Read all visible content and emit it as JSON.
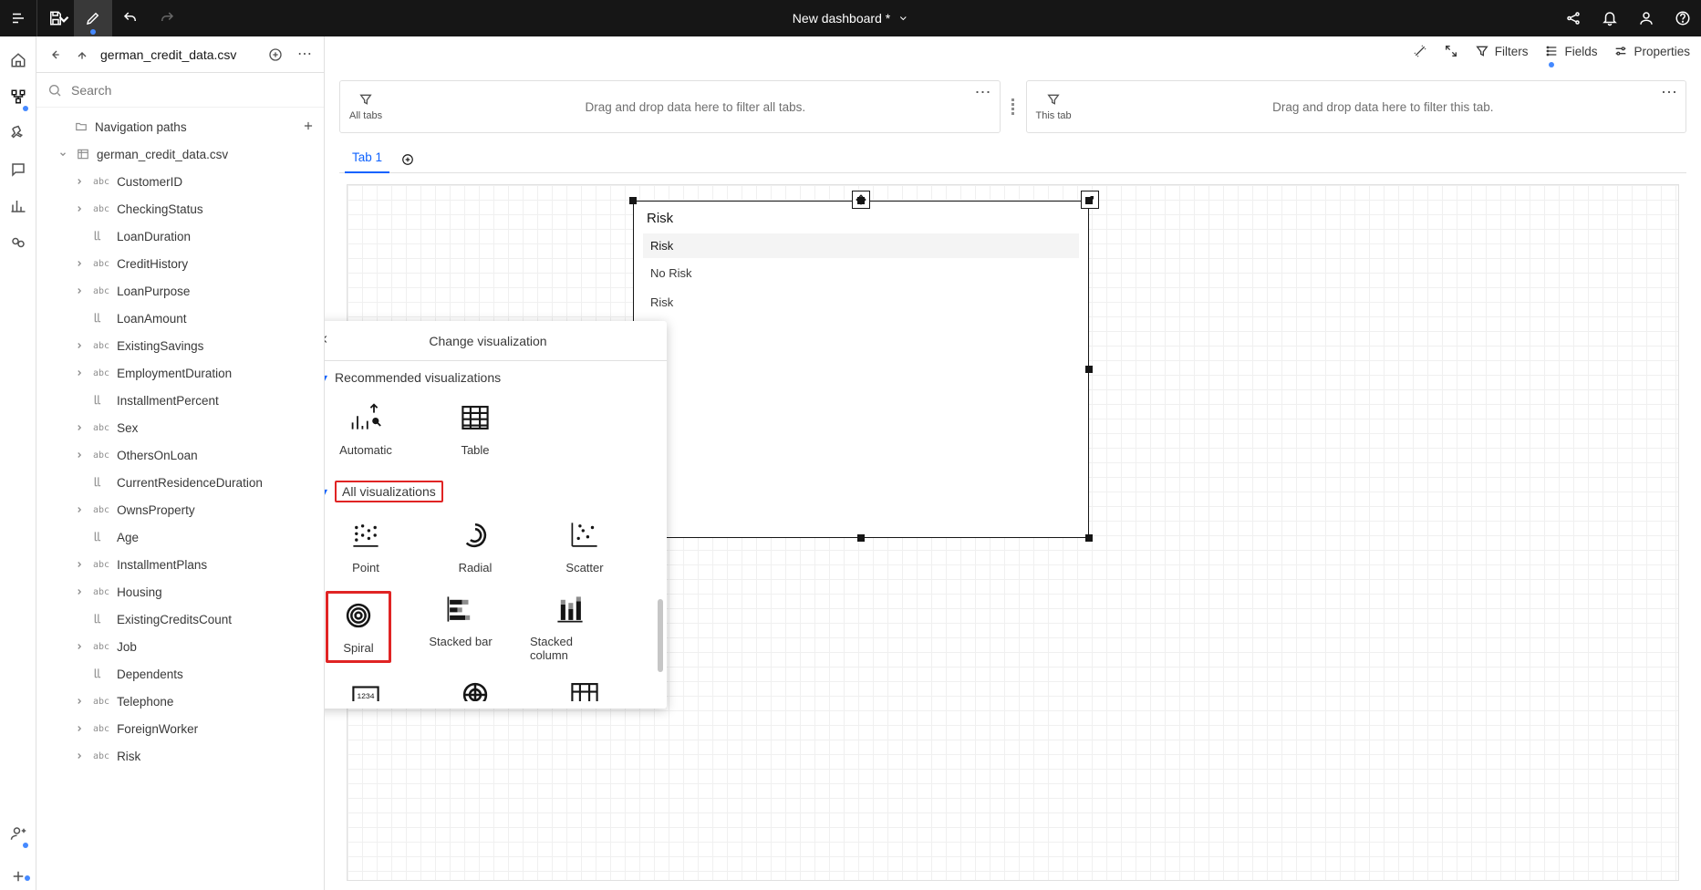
{
  "topbar": {
    "title": "New dashboard *"
  },
  "canvas_toolbar": {
    "filters": "Filters",
    "fields": "Fields",
    "properties": "Properties"
  },
  "sidebar": {
    "file": "german_credit_data.csv",
    "search_placeholder": "Search",
    "nav_paths": "Navigation paths",
    "data_source": "german_credit_data.csv",
    "fields": [
      {
        "type": "abc",
        "name": "CustomerID",
        "expandable": true
      },
      {
        "type": "abc",
        "name": "CheckingStatus",
        "expandable": true
      },
      {
        "type": "num",
        "name": "LoanDuration",
        "expandable": false
      },
      {
        "type": "abc",
        "name": "CreditHistory",
        "expandable": true
      },
      {
        "type": "abc",
        "name": "LoanPurpose",
        "expandable": true
      },
      {
        "type": "num",
        "name": "LoanAmount",
        "expandable": false
      },
      {
        "type": "abc",
        "name": "ExistingSavings",
        "expandable": true
      },
      {
        "type": "abc",
        "name": "EmploymentDuration",
        "expandable": true
      },
      {
        "type": "num",
        "name": "InstallmentPercent",
        "expandable": false
      },
      {
        "type": "abc",
        "name": "Sex",
        "expandable": true
      },
      {
        "type": "abc",
        "name": "OthersOnLoan",
        "expandable": true
      },
      {
        "type": "num",
        "name": "CurrentResidenceDuration",
        "expandable": false
      },
      {
        "type": "abc",
        "name": "OwnsProperty",
        "expandable": true
      },
      {
        "type": "num",
        "name": "Age",
        "expandable": false
      },
      {
        "type": "abc",
        "name": "InstallmentPlans",
        "expandable": true
      },
      {
        "type": "abc",
        "name": "Housing",
        "expandable": true
      },
      {
        "type": "num",
        "name": "ExistingCreditsCount",
        "expandable": false
      },
      {
        "type": "abc",
        "name": "Job",
        "expandable": true
      },
      {
        "type": "num",
        "name": "Dependents",
        "expandable": false
      },
      {
        "type": "abc",
        "name": "Telephone",
        "expandable": true
      },
      {
        "type": "abc",
        "name": "ForeignWorker",
        "expandable": true
      },
      {
        "type": "abc",
        "name": "Risk",
        "expandable": true
      }
    ]
  },
  "filters": {
    "all_tabs_label": "All tabs",
    "all_tabs_text": "Drag and drop data here to filter all tabs.",
    "this_tab_label": "This tab",
    "this_tab_text": "Drag and drop data here to filter this tab."
  },
  "tabs": {
    "tab1": "Tab 1"
  },
  "widget": {
    "title": "Risk",
    "header": "Risk",
    "row1": "No Risk",
    "row2": "Risk"
  },
  "popover": {
    "title": "Change visualization",
    "section_rec": "Recommended visualizations",
    "section_all": "All visualizations",
    "rec": {
      "automatic": "Automatic",
      "table": "Table"
    },
    "all": {
      "point": "Point",
      "radial": "Radial",
      "scatter": "Scatter",
      "spiral": "Spiral",
      "stacked_bar": "Stacked bar",
      "stacked_column": "Stacked column"
    }
  }
}
